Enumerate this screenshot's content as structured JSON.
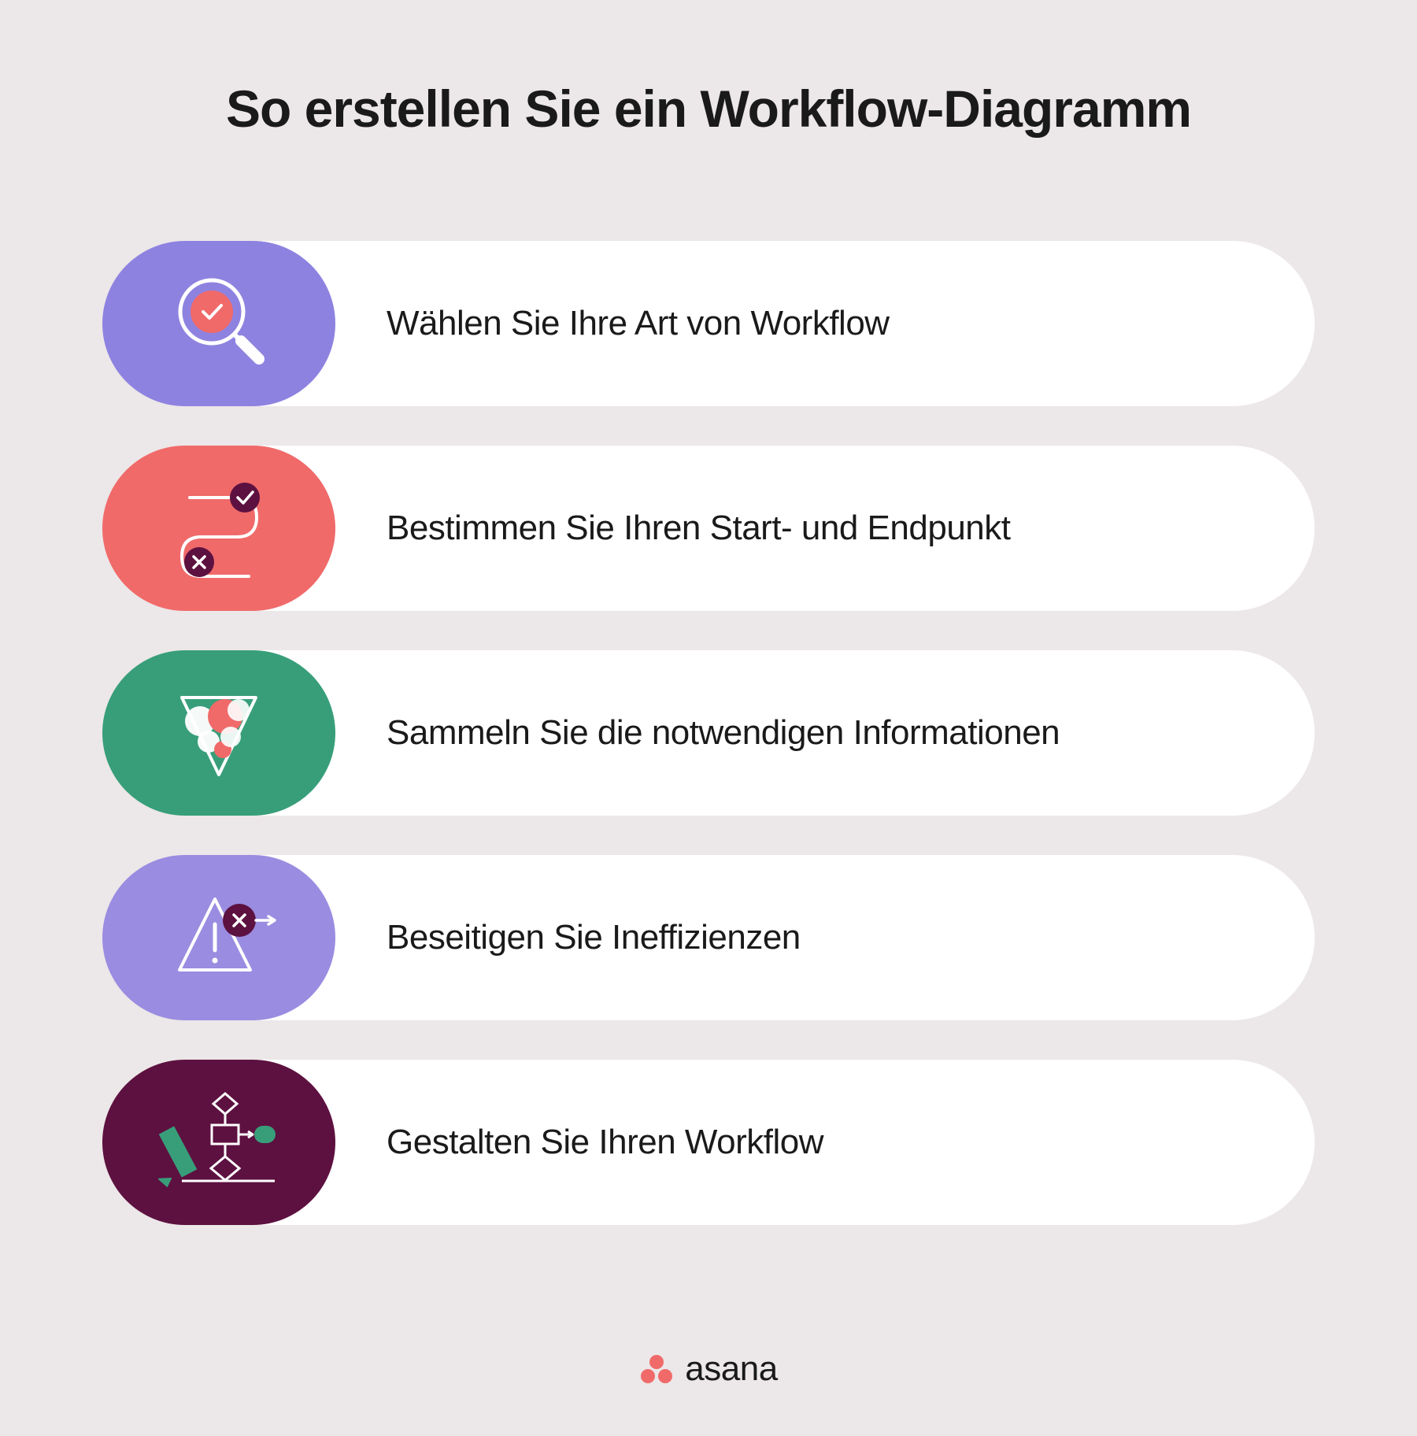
{
  "title": "So erstellen Sie ein Workflow-Diagramm",
  "steps": [
    {
      "label": "Wählen Sie Ihre Art von Workflow",
      "icon_name": "magnifier-check-icon",
      "color": "purple"
    },
    {
      "label": "Bestimmen Sie Ihren Start- und Endpunkt",
      "icon_name": "path-endpoints-icon",
      "color": "coral"
    },
    {
      "label": "Sammeln Sie die notwendigen Informationen",
      "icon_name": "funnel-icon",
      "color": "green"
    },
    {
      "label": "Beseitigen Sie Ineffizienzen",
      "icon_name": "warning-icon",
      "color": "lavender"
    },
    {
      "label": "Gestalten Sie Ihren Workflow",
      "icon_name": "flowchart-icon",
      "color": "maroon"
    }
  ],
  "footer": {
    "brand": "asana",
    "brand_color": "#f06a6a"
  }
}
